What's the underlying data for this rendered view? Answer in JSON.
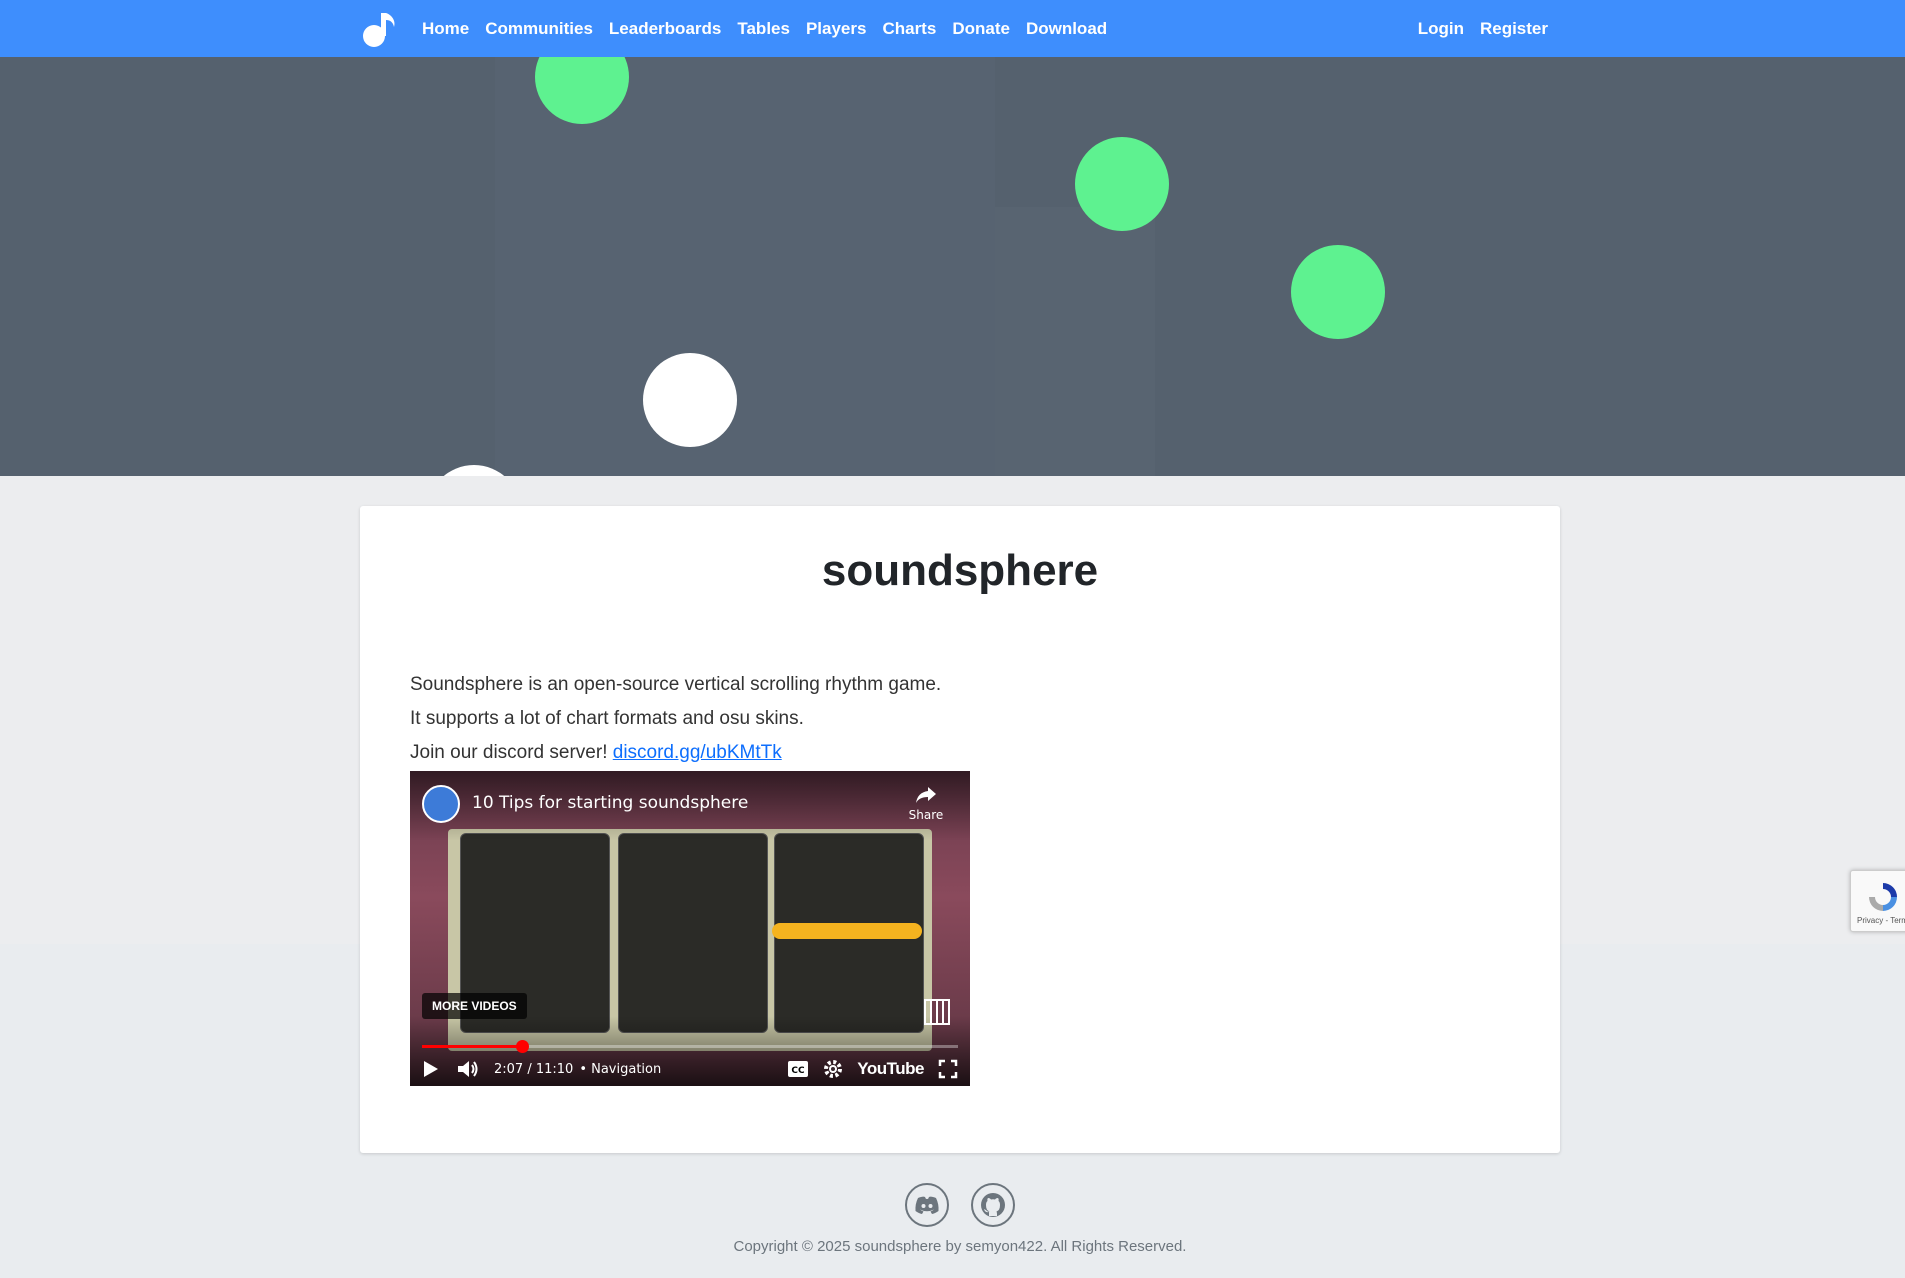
{
  "nav": {
    "links": [
      "Home",
      "Communities",
      "Leaderboards",
      "Tables",
      "Players",
      "Charts",
      "Donate",
      "Download"
    ],
    "login": "Login",
    "register": "Register"
  },
  "card": {
    "title": "soundsphere",
    "line1": "Soundsphere is an open-source vertical scrolling rhythm game.",
    "line2": "It supports a lot of chart formats and osu skins.",
    "line3_prefix": "Join our discord server!",
    "discord_link": "discord.gg/ubKMtTk"
  },
  "video": {
    "title": "10 Tips for starting soundsphere",
    "share": "Share",
    "more_videos": "MORE VIDEOS",
    "time": "2:07 / 11:10",
    "chapter": "• Navigation",
    "progress": 0.186,
    "youtube": "YouTube"
  },
  "recaptcha": {
    "text": "Privacy - Terms"
  },
  "footer": {
    "copyright": "Copyright © 2025 soundsphere by semyon422. All Rights Reserved."
  },
  "colors": {
    "navbar": "#3e8efd",
    "hero": "#55616e",
    "note_green": "#5ef290",
    "note_white": "#ffffff"
  }
}
